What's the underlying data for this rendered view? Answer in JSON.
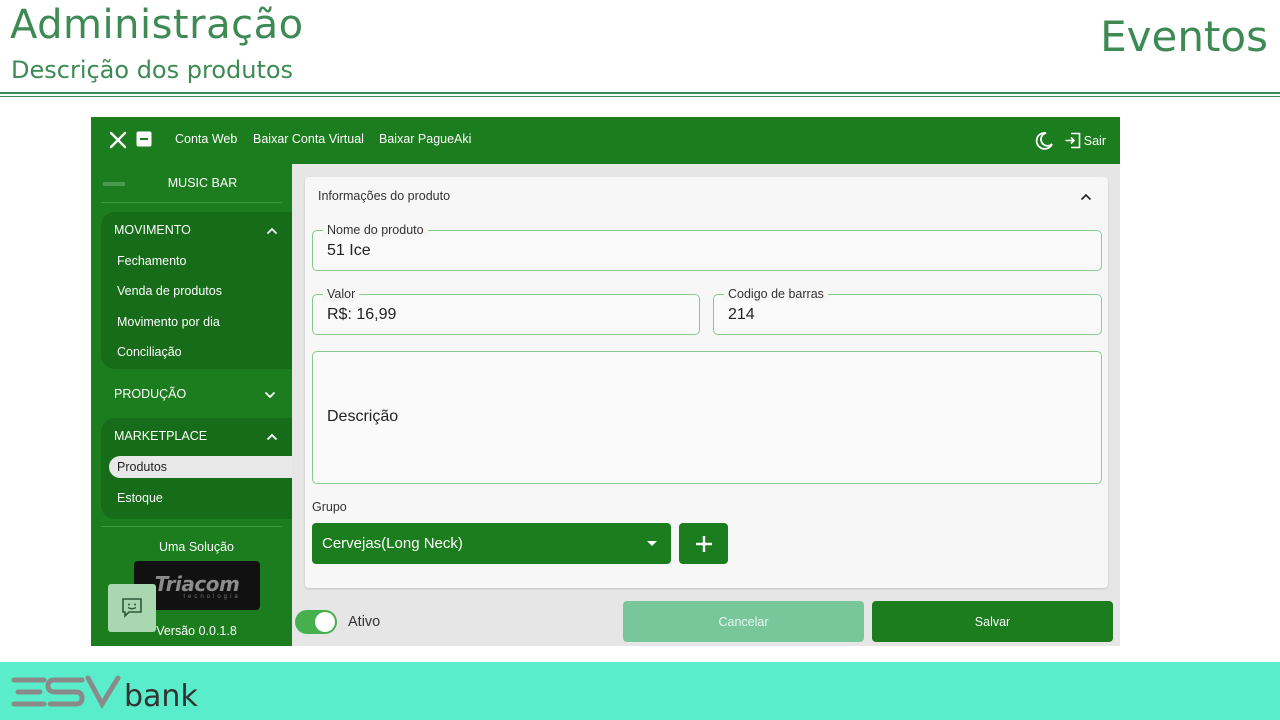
{
  "slide": {
    "title": "Administração",
    "subtitle": "Descrição dos produtos",
    "section": "Eventos"
  },
  "topbar": {
    "links": [
      "Conta Web",
      "Baixar Conta Virtual",
      "Baixar PagueAki"
    ],
    "logout_label": "Sair"
  },
  "sidebar": {
    "brand": "MUSIC BAR",
    "movimento": {
      "header": "MOVIMENTO",
      "items": [
        "Fechamento",
        "Venda de produtos",
        "Movimento por dia",
        "Conciliação"
      ]
    },
    "producao": {
      "header": "PRODUÇÃO"
    },
    "marketplace": {
      "header": "MARKETPLACE",
      "items": [
        "Produtos",
        "Estoque"
      ],
      "active": "Produtos"
    },
    "solution_label": "Uma Solução",
    "partner_logo": {
      "name": "Triacom",
      "tagline": "tecnologia"
    },
    "version": "Versão 0.0.1.8"
  },
  "form": {
    "card_title": "Informações do produto",
    "nome": {
      "label": "Nome do produto",
      "value": "51 Ice"
    },
    "valor": {
      "label": "Valor",
      "value": "R$: 16,99"
    },
    "codigo": {
      "label": "Codigo de barras",
      "value": "214"
    },
    "descricao": {
      "placeholder": "Descrição"
    },
    "grupo": {
      "label": "Grupo",
      "selected": "Cervejas(Long Neck)"
    }
  },
  "footer": {
    "ativo_label": "Ativo",
    "ativo_on": true,
    "cancel_label": "Cancelar",
    "save_label": "Salvar"
  },
  "brand_footer": {
    "logo": "ESV",
    "text": "bank"
  },
  "colors": {
    "primary": "#1b7d1d",
    "primary_dark": "#166c18",
    "cancel": "#77c79b",
    "slide_text": "#3d8a54",
    "footer_bar": "#59edcb"
  }
}
